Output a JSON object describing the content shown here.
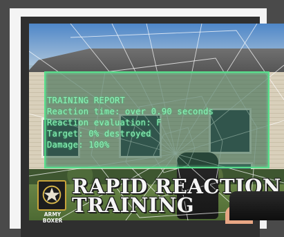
{
  "hud": {
    "title": "TRAINING REPORT",
    "lines": [
      "Reaction time: over 0.90 seconds",
      "Reaction evaluation: F",
      "Target: 0% destroyed",
      "Damage: 100%"
    ],
    "colors": {
      "text": "#8ef0b8",
      "border": "#57e08c",
      "panel": "#285f46"
    }
  },
  "brand": {
    "line1": "RAPID REACTION",
    "line2": "TRAINING",
    "logo_label": "ARMY BOXER",
    "logo_icon": "army-star-emblem"
  },
  "colors": {
    "star": "#d9b84a",
    "outer_frame": "#4a4a4a"
  }
}
